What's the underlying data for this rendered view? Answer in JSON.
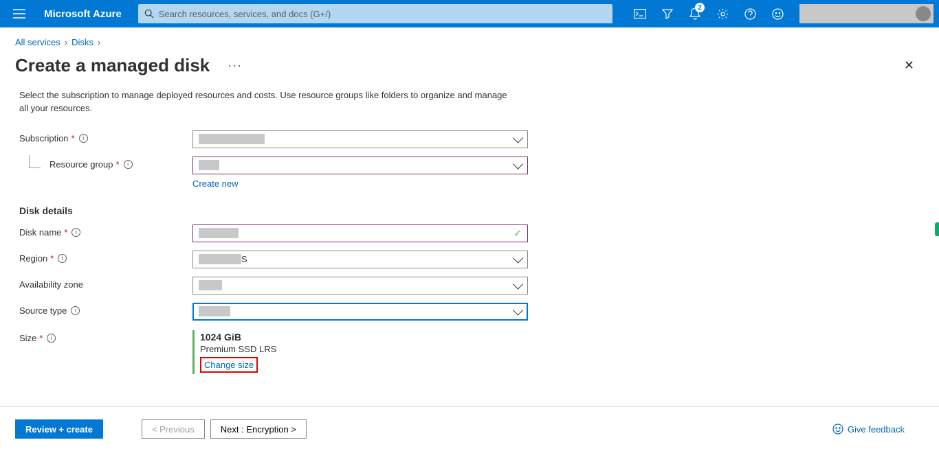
{
  "header": {
    "brand": "Microsoft Azure",
    "search_placeholder": "Search resources, services, and docs (G+/)",
    "notification_count": "2"
  },
  "breadcrumb": {
    "root": "All services",
    "item": "Disks"
  },
  "page": {
    "title": "Create a managed disk",
    "intro": "Select the subscription to manage deployed resources and costs. Use resource groups like folders to organize and manage all your resources."
  },
  "labels": {
    "subscription": "Subscription",
    "resource_group": "Resource group",
    "create_new": "Create new",
    "disk_details": "Disk details",
    "disk_name": "Disk name",
    "region": "Region",
    "availability_zone": "Availability zone",
    "source_type": "Source type",
    "size": "Size"
  },
  "sizeinfo": {
    "value": "1024 GiB",
    "sku": "Premium SSD LRS",
    "change": "Change size"
  },
  "footer": {
    "review": "Review + create",
    "prev": "< Previous",
    "next": "Next : Encryption >",
    "feedback": "Give feedback"
  }
}
